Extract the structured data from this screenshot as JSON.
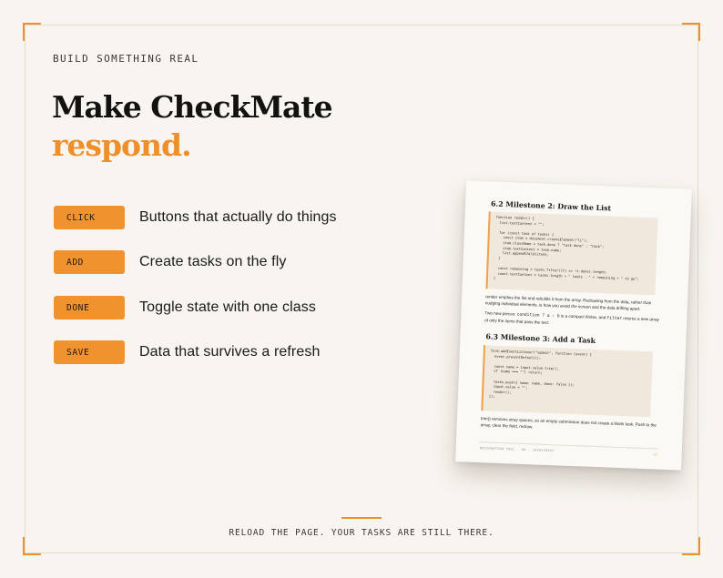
{
  "eyebrow": "BUILD SOMETHING REAL",
  "title": {
    "line1": "Make CheckMate",
    "line2": "respond."
  },
  "features": [
    {
      "tag": "CLICK",
      "text": "Buttons that actually do things"
    },
    {
      "tag": "ADD",
      "text": "Create tasks on the fly"
    },
    {
      "tag": "DONE",
      "text": "Toggle state with one class"
    },
    {
      "tag": "SAVE",
      "text": "Data that survives a refresh"
    }
  ],
  "page": {
    "heading1": "6.2 Milestone 2: Draw the List",
    "code1": "function render() {\n  list.textContent = \"\";\n\n  for (const task of tasks) {\n    const item = document.createElement(\"li\");\n    item.className = task.done ? \"task done\" : \"task\";\n    item.textContent = task.name;\n    list.appendChild(item);\n  }\n\n  const remaining = tasks.filter((t) => !t.done).length;\n  count.textContent = tasks.length + \" tasks · \" + remaining + \" to go\";\n}",
    "para1": "render empties the list and rebuilds it from the array. Redrawing from the data, rather than nudging individual elements, is how you avoid the screen and the data drifting apart.",
    "para2_a": "Two new pieces: ",
    "para2_code1": "condition ? a : b",
    "para2_b": " is a compact if/else, and ",
    "para2_code2": "filter",
    "para2_c": " returns a new array of only the items that pass the test.",
    "heading2": "6.3 Milestone 3: Add a Task",
    "code2": "form.addEventListener(\"submit\", function (event) {\n  event.preventDefault();\n\n  const name = input.value.trim();\n  if (name === \"\") return;\n\n  tasks.push({ name: name, done: false });\n  input.value = \"\";\n  render();\n});",
    "para3": "trim() removes stray spaces, so an empty submission does not create a blank task. Push to the array, clear the field, redraw.",
    "footer": "DESIGNATION TOOL · 06 · JAVASCRIPT",
    "page_number": "27"
  },
  "bottom_line": "RELOAD THE PAGE. YOUR TASKS ARE STILL THERE.",
  "colors": {
    "accent": "#ef8f2b",
    "background": "#f8f5f0",
    "tag": "#f0922e",
    "code_bg": "#f1e8dc"
  }
}
